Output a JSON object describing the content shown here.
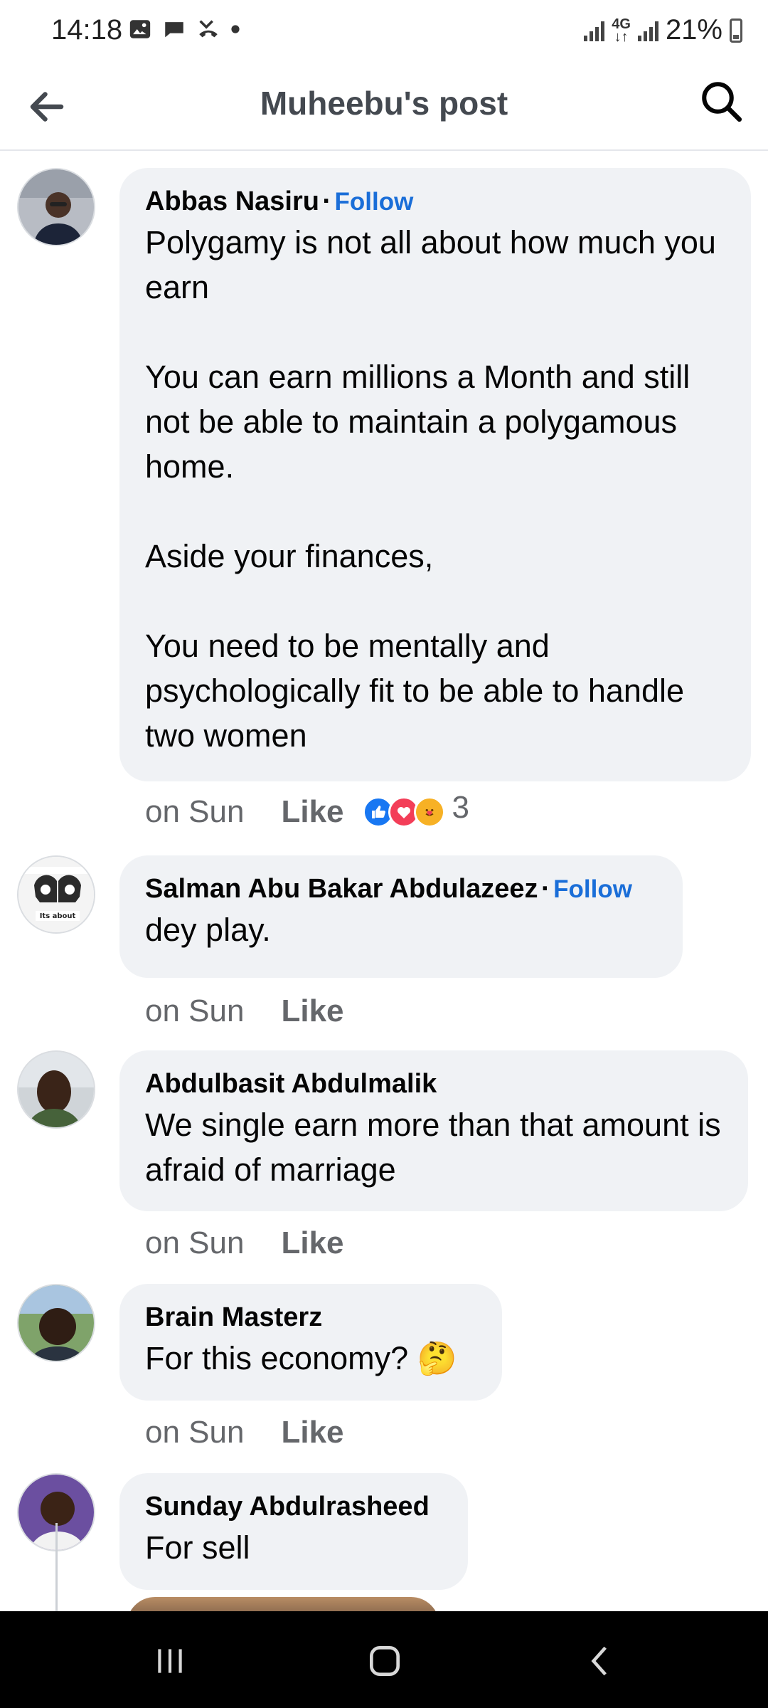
{
  "status_bar": {
    "time": "14:18",
    "network": "4G",
    "battery": "21%"
  },
  "header": {
    "title": "Muheebu's post"
  },
  "comments": [
    {
      "author": "Abbas Nasiru",
      "follow": "Follow",
      "text": "Polygamy is not all about how much you earn\n\nYou can earn millions a Month and still not be able to maintain a polygamous home.\n\nAside your finances,\n\nYou need to be mentally and psychologically fit to be able to handle two women",
      "time": "on Sun",
      "like": "Like",
      "reaction_count": "3"
    },
    {
      "author": "Salman Abu Bakar Abdulazeez",
      "follow": "Follow",
      "text": "dey play.",
      "time": "on Sun",
      "like": "Like"
    },
    {
      "author": "Abdulbasit Abdulmalik",
      "text": "We single earn more than that amount is afraid of marriage",
      "time": "on Sun",
      "like": "Like"
    },
    {
      "author": "Brain Masterz",
      "text": "For this economy? 🤔",
      "time": "on Sun",
      "like": "Like"
    },
    {
      "author": "Sunday Abdulrasheed",
      "text": "For sell"
    }
  ],
  "avatar_logo_text": "Its about",
  "colors": {
    "link": "#1a6ed8",
    "bubble": "#f0f2f5",
    "muted": "#65676b"
  }
}
